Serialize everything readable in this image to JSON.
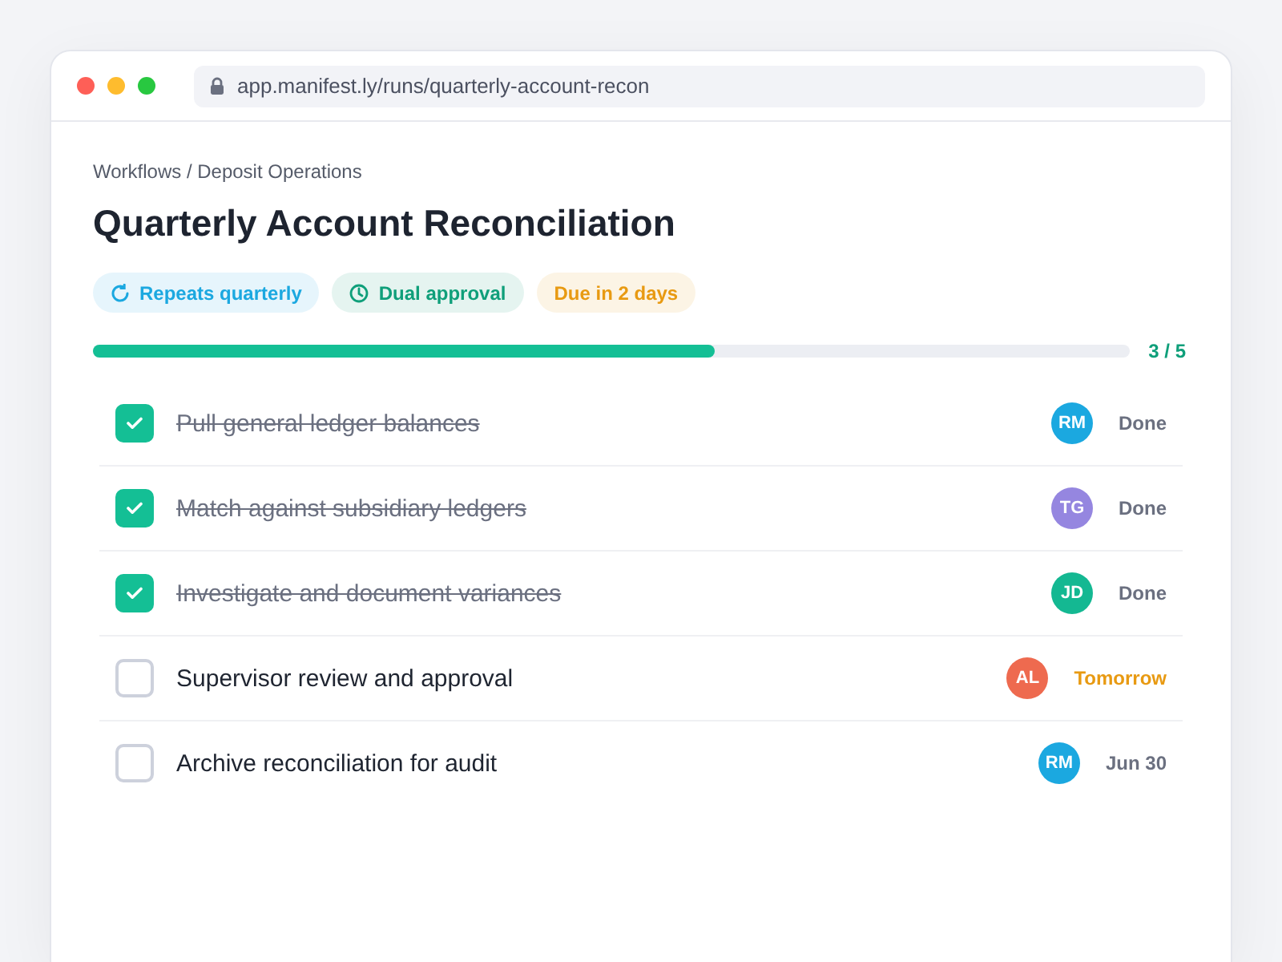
{
  "browser": {
    "url": "app.manifest.ly/runs/quarterly-account-recon"
  },
  "breadcrumb": "Workflows / Deposit Operations",
  "title": "Quarterly Account Reconciliation",
  "tags": [
    {
      "kind": "repeat",
      "label": "Repeats quarterly",
      "color": "#1ba8e0"
    },
    {
      "kind": "clock",
      "label": "Dual approval",
      "color": "#0f9f7a"
    },
    {
      "kind": "plain",
      "label": "Due in 2 days",
      "color": "#e89a12"
    }
  ],
  "progress": {
    "level": 0.6,
    "reading": "3 / 5"
  },
  "tasks": [
    {
      "label": "Pull general ledger balances",
      "checked": true,
      "assignee": "RM",
      "color": "#1ba8e0",
      "status": "Done",
      "urgent": false
    },
    {
      "label": "Match against subsidiary ledgers",
      "checked": true,
      "assignee": "TG",
      "color": "#9586e0",
      "status": "Done",
      "urgent": false
    },
    {
      "label": "Investigate and document variances",
      "checked": true,
      "assignee": "JD",
      "color": "#14b892",
      "status": "Done",
      "urgent": false
    },
    {
      "label": "Supervisor review and approval",
      "checked": false,
      "assignee": "AL",
      "color": "#ee6a4f",
      "status": "Tomorrow",
      "urgent": true
    },
    {
      "label": "Archive reconciliation for audit",
      "checked": false,
      "assignee": "RM",
      "color": "#1ba8e0",
      "status": "Jun 30",
      "urgent": false
    }
  ]
}
